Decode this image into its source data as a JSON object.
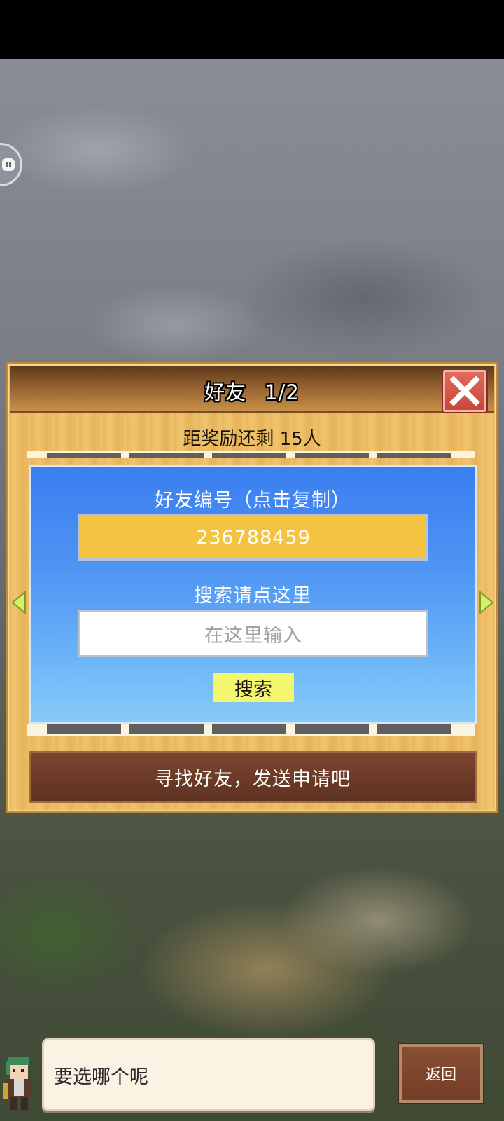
{
  "panel": {
    "title": "好友",
    "page": "1/2",
    "reward_text": "距奖励还剩 15人"
  },
  "friend_id": {
    "label": "好友编号（点击复制）",
    "value": "236788459"
  },
  "search": {
    "hint": "搜索请点这里",
    "placeholder": "在这里输入",
    "button_label": "搜索"
  },
  "find_friend_label": "寻找好友，发送申请吧",
  "dialog": {
    "text": "要选哪个呢",
    "back_label": "返回"
  },
  "colors": {
    "panel_wood": "#efc26b",
    "header_brown": "#8c5c2c",
    "close_red": "#d5564a",
    "blue_box_top": "#3a7ef0",
    "friend_id_yellow": "#f5c342",
    "search_button_yellow": "#f4f76e",
    "brown_button": "#6d3b27"
  },
  "icons": [
    "chat-bubble-icon",
    "close-x-icon",
    "arrow-left-icon",
    "arrow-right-icon",
    "character-avatar"
  ]
}
